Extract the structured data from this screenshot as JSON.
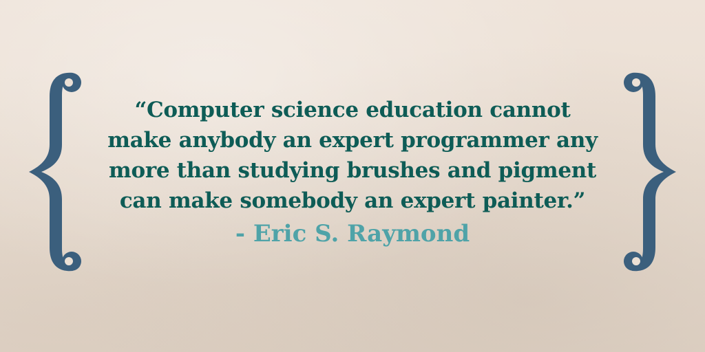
{
  "quote": {
    "lines": [
      "“Computer science education cannot",
      "make anybody an expert programmer any",
      "more than studying brushes and pigment",
      "can make somebody an expert painter.”"
    ],
    "attribution": "- Eric S. Raymond"
  },
  "colors": {
    "background": "#ebe0d5",
    "brace": "#3b5f7d",
    "quote_text": "#0e5c56",
    "attribution_text": "#4fa3a8"
  },
  "icons": {
    "left": "left-curly-brace-icon",
    "right": "right-curly-brace-icon"
  }
}
